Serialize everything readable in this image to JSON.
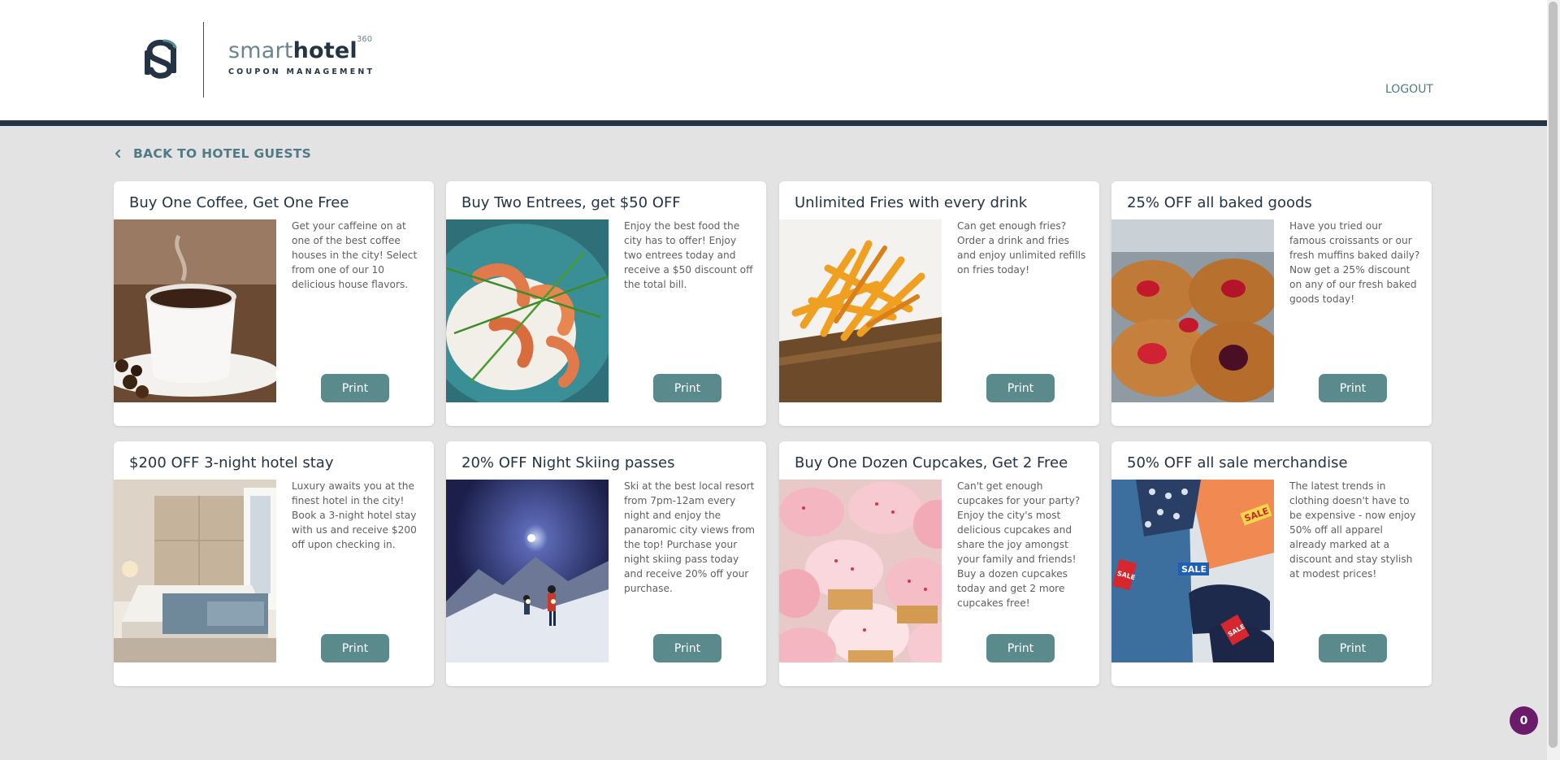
{
  "header": {
    "brand_light": "smart",
    "brand_bold": "hotel",
    "brand_sup": "360",
    "brand_sub": "COUPON MANAGEMENT",
    "logout_label": "LOGOUT"
  },
  "nav": {
    "back_label": "BACK TO HOTEL GUESTS"
  },
  "coupons": [
    {
      "title": "Buy One Coffee, Get One Free",
      "description": "Get your caffeine on at one of the best coffee houses in the city! Select from one of our 10 delicious house flavors.",
      "button_label": "Print",
      "image": "coffee-cup-image"
    },
    {
      "title": "Buy Two Entrees, get $50 OFF",
      "description": "Enjoy the best food the city has to offer! Enjoy two entrees today and receive a $50 discount off the total bill.",
      "button_label": "Print",
      "image": "shrimp-rice-plate-image"
    },
    {
      "title": "Unlimited Fries with every drink",
      "description": "Can get enough fries? Order a drink and fries and enjoy unlimited refills on fries today!",
      "button_label": "Print",
      "image": "french-fries-image"
    },
    {
      "title": "25% OFF all baked goods",
      "description": "Have you tried our famous croissants or our fresh muffins baked daily? Now get a 25% discount on any of our fresh baked goods today!",
      "button_label": "Print",
      "image": "pastries-image"
    },
    {
      "title": "$200 OFF 3-night hotel stay",
      "description": "Luxury awaits you at the finest hotel in the city! Book a 3-night hotel stay with us and receive $200 off upon checking in.",
      "button_label": "Print",
      "image": "hotel-room-image"
    },
    {
      "title": "20% OFF Night Skiing passes",
      "description": "Ski at the best local resort from 7pm-12am every night and enjoy the panaromic city views from the top! Purchase your night skiing pass today and receive 20% off your purchase.",
      "button_label": "Print",
      "image": "night-skiing-image"
    },
    {
      "title": "Buy One Dozen Cupcakes, Get 2 Free",
      "description": "Can't get enough cupcakes for your party? Enjoy the city's most delicious cupcakes and share the joy amongst your family and friends! Buy a dozen cupcakes today and get 2 more cupcakes free!",
      "button_label": "Print",
      "image": "cupcakes-image"
    },
    {
      "title": "50% OFF all sale merchandise",
      "description": "The latest trends in clothing doesn't have to be expensive - now enjoy 50% off all apparel already marked at a discount and stay stylish at modest prices!",
      "button_label": "Print",
      "image": "sale-clothing-image",
      "image_tags": [
        "SALE",
        "SALE",
        "SALE",
        "SALE"
      ]
    }
  ],
  "chat_badge": {
    "count": "0"
  },
  "colors": {
    "header_bar": "#243444",
    "accent_button": "#5a8a8c",
    "link": "#4f7a86",
    "badge": "#6a1b6a",
    "background": "#e3e3e3"
  }
}
